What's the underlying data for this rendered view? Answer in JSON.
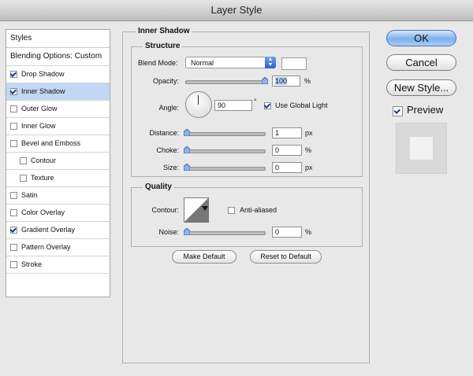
{
  "window": {
    "title": "Layer Style"
  },
  "styles_panel": {
    "header": "Styles",
    "blending_options": "Blending Options: Custom",
    "items": [
      {
        "label": "Drop Shadow",
        "checked": true,
        "active": false,
        "indent": false
      },
      {
        "label": "Inner Shadow",
        "checked": true,
        "active": true,
        "indent": false
      },
      {
        "label": "Outer Glow",
        "checked": false,
        "active": false,
        "indent": false
      },
      {
        "label": "Inner Glow",
        "checked": false,
        "active": false,
        "indent": false
      },
      {
        "label": "Bevel and Emboss",
        "checked": false,
        "active": false,
        "indent": false
      },
      {
        "label": "Contour",
        "checked": false,
        "active": false,
        "indent": true
      },
      {
        "label": "Texture",
        "checked": false,
        "active": false,
        "indent": true
      },
      {
        "label": "Satin",
        "checked": false,
        "active": false,
        "indent": false
      },
      {
        "label": "Color Overlay",
        "checked": false,
        "active": false,
        "indent": false
      },
      {
        "label": "Gradient Overlay",
        "checked": true,
        "active": false,
        "indent": false
      },
      {
        "label": "Pattern Overlay",
        "checked": false,
        "active": false,
        "indent": false
      },
      {
        "label": "Stroke",
        "checked": false,
        "active": false,
        "indent": false
      }
    ]
  },
  "inner_shadow": {
    "title": "Inner Shadow",
    "structure": {
      "title": "Structure",
      "blend_mode_label": "Blend Mode:",
      "blend_mode_value": "Normal",
      "swatch_color": "#ffffff",
      "opacity_label": "Opacity:",
      "opacity_value": "100",
      "opacity_unit": "%",
      "angle_label": "Angle:",
      "angle_value": "90",
      "angle_unit": "°",
      "use_global_light_label": "Use Global Light",
      "use_global_light_checked": true,
      "distance_label": "Distance:",
      "distance_value": "1",
      "distance_unit": "px",
      "choke_label": "Choke:",
      "choke_value": "0",
      "choke_unit": "%",
      "size_label": "Size:",
      "size_value": "0",
      "size_unit": "px"
    },
    "quality": {
      "title": "Quality",
      "contour_label": "Contour:",
      "anti_aliased_label": "Anti-aliased",
      "anti_aliased_checked": false,
      "noise_label": "Noise:",
      "noise_value": "0",
      "noise_unit": "%"
    },
    "make_default_label": "Make Default",
    "reset_default_label": "Reset to Default"
  },
  "buttons": {
    "ok_label": "OK",
    "cancel_label": "Cancel",
    "new_style_label": "New Style...",
    "preview_label": "Preview",
    "preview_checked": true
  },
  "colors": {
    "accent": "#6f9ee8",
    "selection": "#c2d7f4"
  }
}
